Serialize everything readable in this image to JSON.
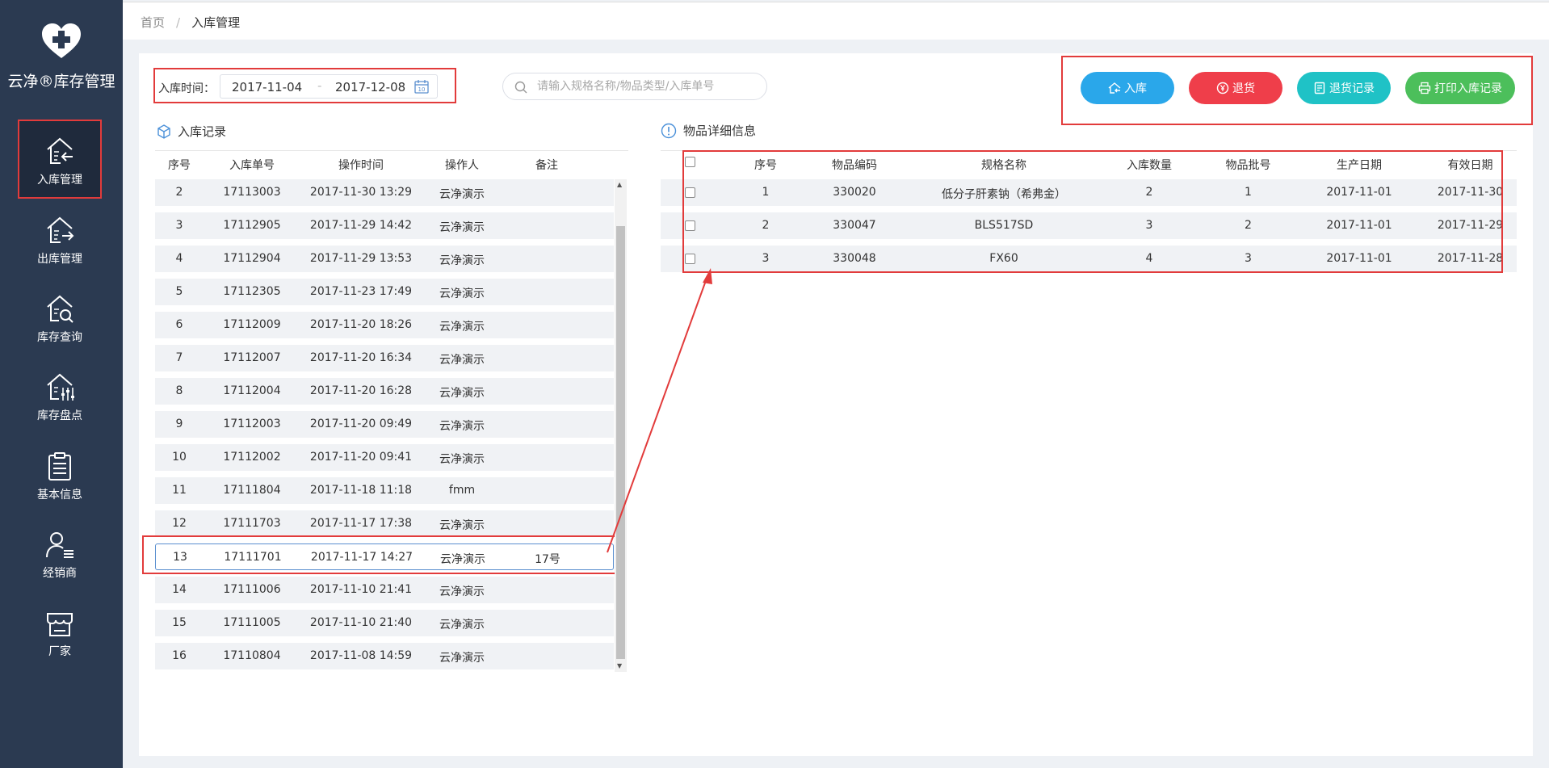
{
  "app": {
    "name": "云净®库存管理"
  },
  "sidebar": {
    "items": [
      {
        "label": "入库管理",
        "icon": "house-arrow-in-icon",
        "active": true
      },
      {
        "label": "出库管理",
        "icon": "house-arrow-out-icon"
      },
      {
        "label": "库存查询",
        "icon": "house-search-icon"
      },
      {
        "label": "库存盘点",
        "icon": "house-sliders-icon"
      },
      {
        "label": "基本信息",
        "icon": "clipboard-icon"
      },
      {
        "label": "经销商",
        "icon": "user-list-icon"
      },
      {
        "label": "厂家",
        "icon": "store-icon"
      }
    ]
  },
  "breadcrumb": {
    "home": "首页",
    "sep": "/",
    "current": "入库管理"
  },
  "filter": {
    "date_label": "入库时间：",
    "start": "2017-11-04",
    "dash": "-",
    "end": "2017-12-08",
    "search_placeholder": "请输入规格名称/物品类型/入库单号"
  },
  "actions": {
    "inbound": "入库",
    "return": "退货",
    "return_records": "退货记录",
    "print_records": "打印入库记录",
    "colors": {
      "inbound": "#2aa7ea",
      "return": "#ef3e4a",
      "return_records": "#1fc2c6",
      "print_records": "#4cbf5b"
    }
  },
  "left": {
    "title": "入库记录",
    "headers": [
      "序号",
      "入库单号",
      "操作时间",
      "操作人",
      "备注"
    ],
    "rows": [
      [
        "2",
        "17113003",
        "2017-11-30 13:29",
        "云净演示",
        ""
      ],
      [
        "3",
        "17112905",
        "2017-11-29 14:42",
        "云净演示",
        ""
      ],
      [
        "4",
        "17112904",
        "2017-11-29 13:53",
        "云净演示",
        ""
      ],
      [
        "5",
        "17112305",
        "2017-11-23 17:49",
        "云净演示",
        ""
      ],
      [
        "6",
        "17112009",
        "2017-11-20 18:26",
        "云净演示",
        ""
      ],
      [
        "7",
        "17112007",
        "2017-11-20 16:34",
        "云净演示",
        ""
      ],
      [
        "8",
        "17112004",
        "2017-11-20 16:28",
        "云净演示",
        ""
      ],
      [
        "9",
        "17112003",
        "2017-11-20 09:49",
        "云净演示",
        ""
      ],
      [
        "10",
        "17112002",
        "2017-11-20 09:41",
        "云净演示",
        ""
      ],
      [
        "11",
        "17111804",
        "2017-11-18 11:18",
        "fmm",
        ""
      ],
      [
        "12",
        "17111703",
        "2017-11-17 17:38",
        "云净演示",
        ""
      ],
      [
        "13",
        "17111701",
        "2017-11-17 14:27",
        "云净演示",
        "17号"
      ],
      [
        "14",
        "17111006",
        "2017-11-10 21:41",
        "云净演示",
        ""
      ],
      [
        "15",
        "17111005",
        "2017-11-10 21:40",
        "云净演示",
        ""
      ],
      [
        "16",
        "17110804",
        "2017-11-08 14:59",
        "云净演示",
        ""
      ]
    ],
    "selected_row": "13"
  },
  "right": {
    "title": "物品详细信息",
    "headers": [
      "序号",
      "物品编码",
      "规格名称",
      "入库数量",
      "物品批号",
      "生产日期",
      "有效日期"
    ],
    "rows": [
      [
        "1",
        "330020",
        "低分子肝素钠（希弗金）",
        "2",
        "1",
        "2017-11-01",
        "2017-11-30"
      ],
      [
        "2",
        "330047",
        "BLS517SD",
        "3",
        "2",
        "2017-11-01",
        "2017-11-29"
      ],
      [
        "3",
        "330048",
        "FX60",
        "4",
        "3",
        "2017-11-01",
        "2017-11-28"
      ]
    ]
  },
  "colors": {
    "sidebar": "#2b3a51",
    "highlight": "#e23b3b"
  }
}
